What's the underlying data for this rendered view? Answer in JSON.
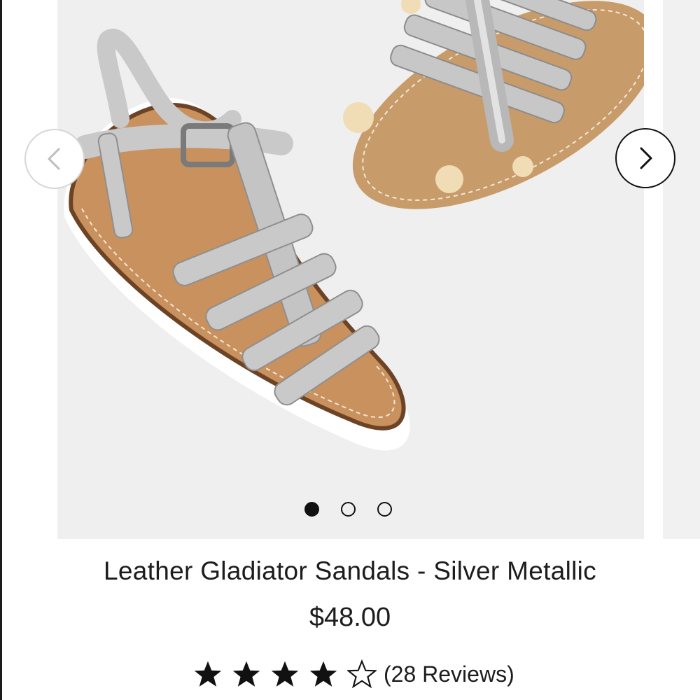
{
  "product": {
    "title": "Leather Gladiator Sandals - Silver Metallic",
    "price": "$48.00",
    "rating": 4,
    "rating_max": 5,
    "reviews_label": "(28 Reviews)"
  },
  "carousel": {
    "slide_count": 3,
    "active_slide": 1,
    "prev_icon": "chevron-left-icon",
    "next_icon": "chevron-right-icon"
  },
  "colors": {
    "text": "#1c1c1c",
    "star": "#111111",
    "image_background": "#efefef"
  }
}
